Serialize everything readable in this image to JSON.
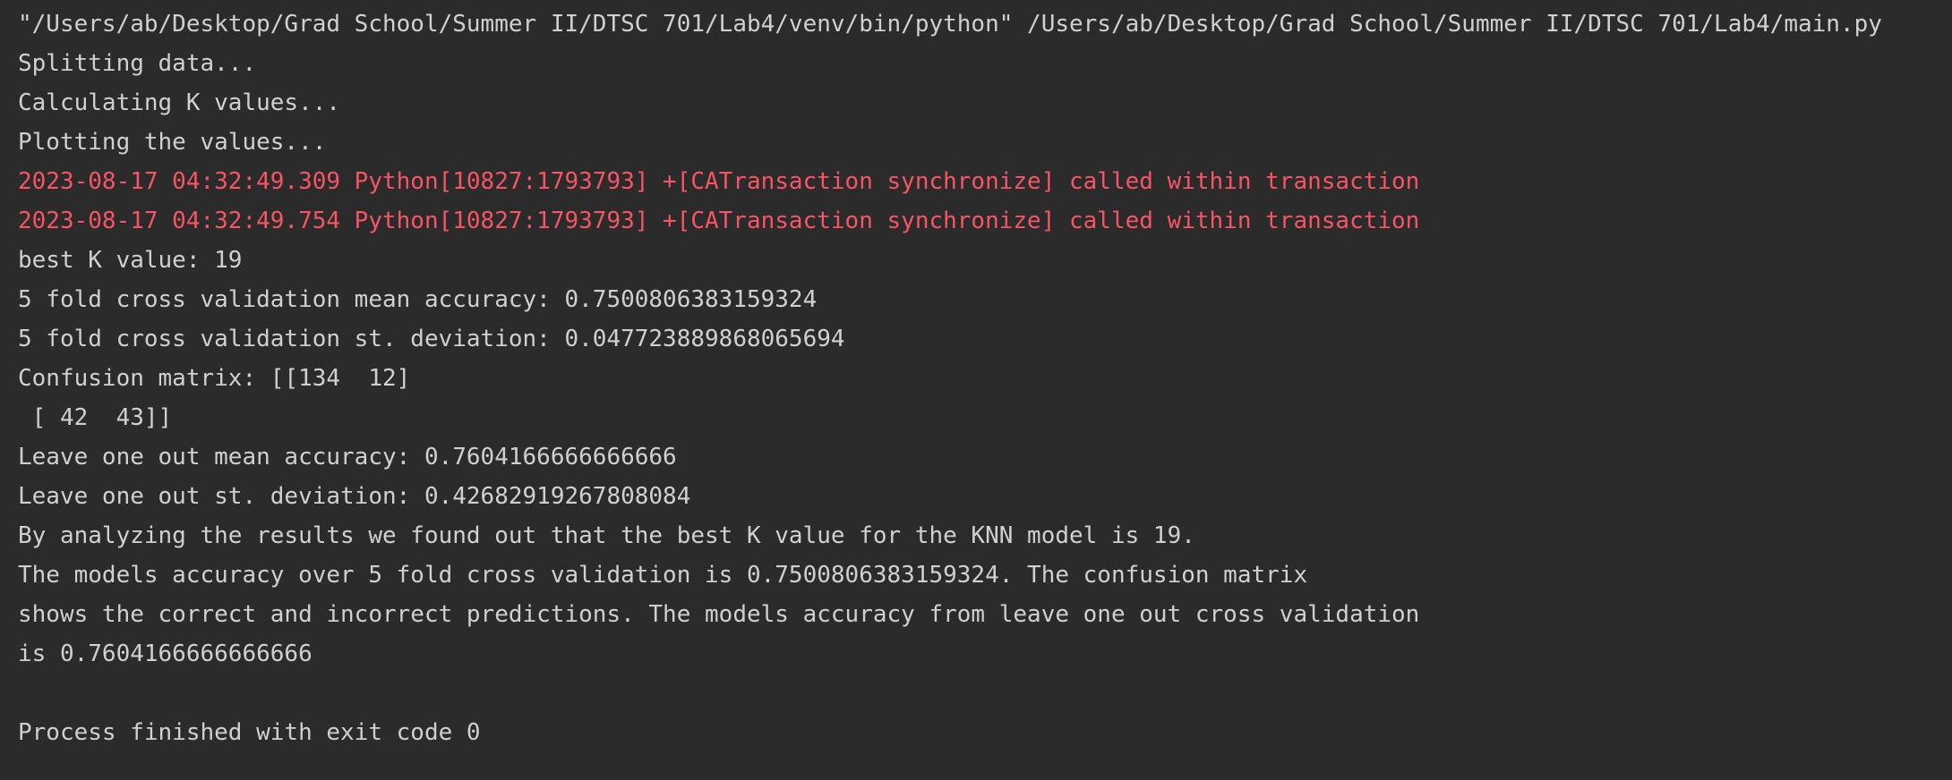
{
  "console": {
    "lines": [
      {
        "kind": "cmd",
        "text": "\"/Users/ab/Desktop/Grad School/Summer II/DTSC 701/Lab4/venv/bin/python\" /Users/ab/Desktop/Grad School/Summer II/DTSC 701/Lab4/main.py"
      },
      {
        "kind": "stdout",
        "text": "Splitting data..."
      },
      {
        "kind": "stdout",
        "text": "Calculating K values..."
      },
      {
        "kind": "stdout",
        "text": "Plotting the values..."
      },
      {
        "kind": "stderr",
        "text": "2023-08-17 04:32:49.309 Python[10827:1793793] +[CATransaction synchronize] called within transaction"
      },
      {
        "kind": "stderr",
        "text": "2023-08-17 04:32:49.754 Python[10827:1793793] +[CATransaction synchronize] called within transaction"
      },
      {
        "kind": "stdout",
        "text": "best K value: 19"
      },
      {
        "kind": "stdout",
        "text": "5 fold cross validation mean accuracy: 0.7500806383159324"
      },
      {
        "kind": "stdout",
        "text": "5 fold cross validation st. deviation: 0.047723889868065694"
      },
      {
        "kind": "stdout",
        "text": "Confusion matrix: [[134  12]"
      },
      {
        "kind": "stdout",
        "text": " [ 42  43]]"
      },
      {
        "kind": "stdout",
        "text": "Leave one out mean accuracy: 0.7604166666666666"
      },
      {
        "kind": "stdout",
        "text": "Leave one out st. deviation: 0.42682919267808084"
      },
      {
        "kind": "stdout",
        "text": "By analyzing the results we found out that the best K value for the KNN model is 19."
      },
      {
        "kind": "stdout",
        "text": "The models accuracy over 5 fold cross validation is 0.7500806383159324. The confusion matrix"
      },
      {
        "kind": "stdout",
        "text": "shows the correct and incorrect predictions. The models accuracy from leave one out cross validation"
      },
      {
        "kind": "stdout",
        "text": "is 0.7604166666666666"
      },
      {
        "kind": "blank",
        "text": ""
      },
      {
        "kind": "stdout",
        "text": "Process finished with exit code 0"
      }
    ]
  },
  "colors": {
    "background": "#2b2b2b",
    "stdout": "#d0d0d0",
    "stderr": "#f75464"
  }
}
